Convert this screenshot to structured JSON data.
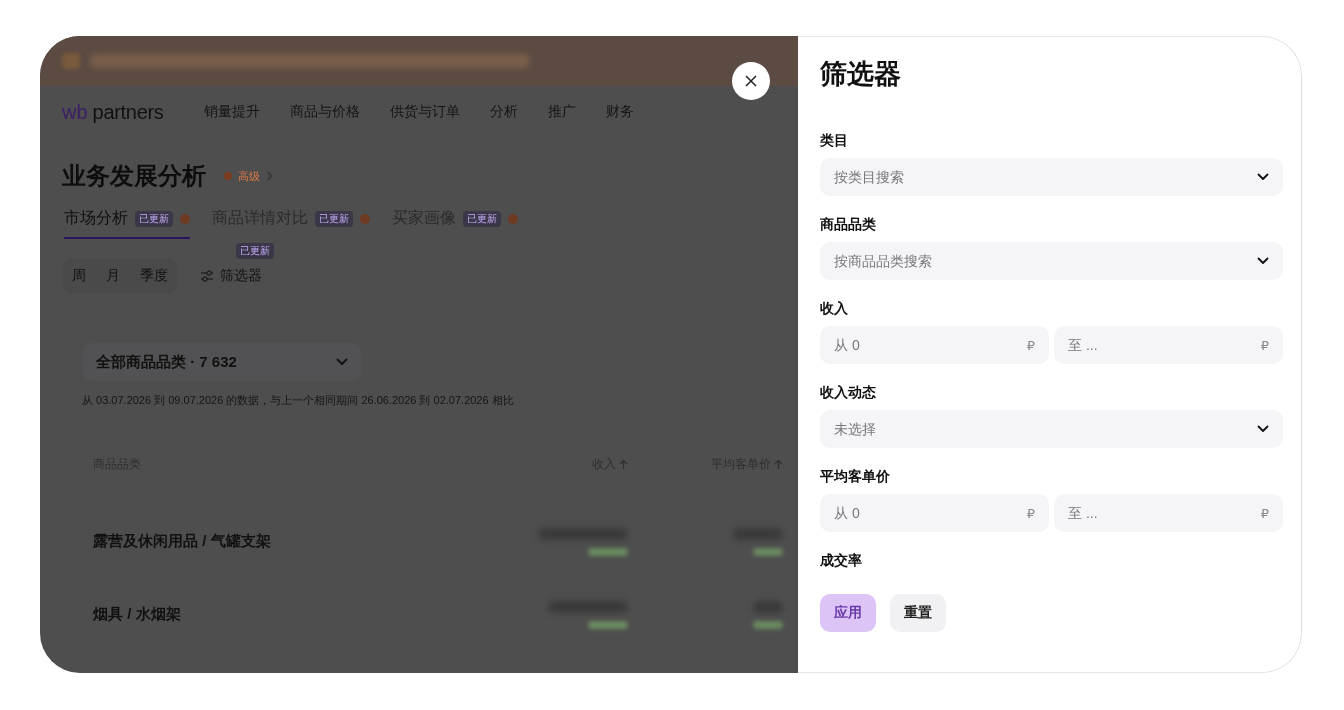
{
  "header": {
    "logo": {
      "mark": "wb",
      "name": "partners"
    },
    "nav": [
      {
        "label": "销量提升"
      },
      {
        "label": "商品与价格"
      },
      {
        "label": "供货与订单"
      },
      {
        "label": "分析"
      },
      {
        "label": "推广"
      },
      {
        "label": "财务"
      }
    ]
  },
  "page": {
    "title": "业务发展分析",
    "title_badge": {
      "label": "高级"
    },
    "tabs": [
      {
        "label": "市场分析",
        "badge": "已更新",
        "selected": true
      },
      {
        "label": "商品详情对比",
        "badge": "已更新",
        "selected": false
      },
      {
        "label": "买家画像",
        "badge": "已更新",
        "selected": false
      }
    ],
    "periods": [
      {
        "label": "周"
      },
      {
        "label": "月"
      },
      {
        "label": "季度"
      }
    ],
    "filter_button": {
      "label": "筛选器",
      "badge": "已更新"
    },
    "category_select": {
      "value": "全部商品品类 · 7 632"
    },
    "caption": "从 03.07.2026 到 09.07.2026 的数据，与上一个相同期间 26.06.2026 到 02.07.2026 相比",
    "table": {
      "columns": [
        {
          "label": "商品品类"
        },
        {
          "label": "收入",
          "ascending": true
        },
        {
          "label": "平均客单价",
          "ascending": true
        }
      ],
      "rows": [
        {
          "category": "露营及休闲用品 / 气罐支架"
        },
        {
          "category": "烟具 / 水烟架"
        }
      ]
    }
  },
  "drawer": {
    "title": "筛选器",
    "fields": [
      {
        "kind": "select",
        "label": "类目",
        "placeholder": "按类目搜索"
      },
      {
        "kind": "select",
        "label": "商品品类",
        "placeholder": "按商品品类搜索"
      },
      {
        "kind": "range",
        "label": "收入",
        "from": {
          "placeholder": "从 0",
          "unit": "₽"
        },
        "to": {
          "placeholder": "至 ...",
          "unit": "₽"
        }
      },
      {
        "kind": "select",
        "label": "收入动态",
        "placeholder": "未选择"
      },
      {
        "kind": "range",
        "label": "平均客单价",
        "from": {
          "placeholder": "从 0",
          "unit": "₽"
        },
        "to": {
          "placeholder": "至 ...",
          "unit": "₽"
        }
      },
      {
        "kind": "heading",
        "label": "成交率"
      }
    ],
    "buttons": [
      {
        "label": "应用",
        "kind": "primary",
        "disabled": true
      },
      {
        "label": "重置",
        "kind": "secondary",
        "disabled": false
      }
    ]
  }
}
